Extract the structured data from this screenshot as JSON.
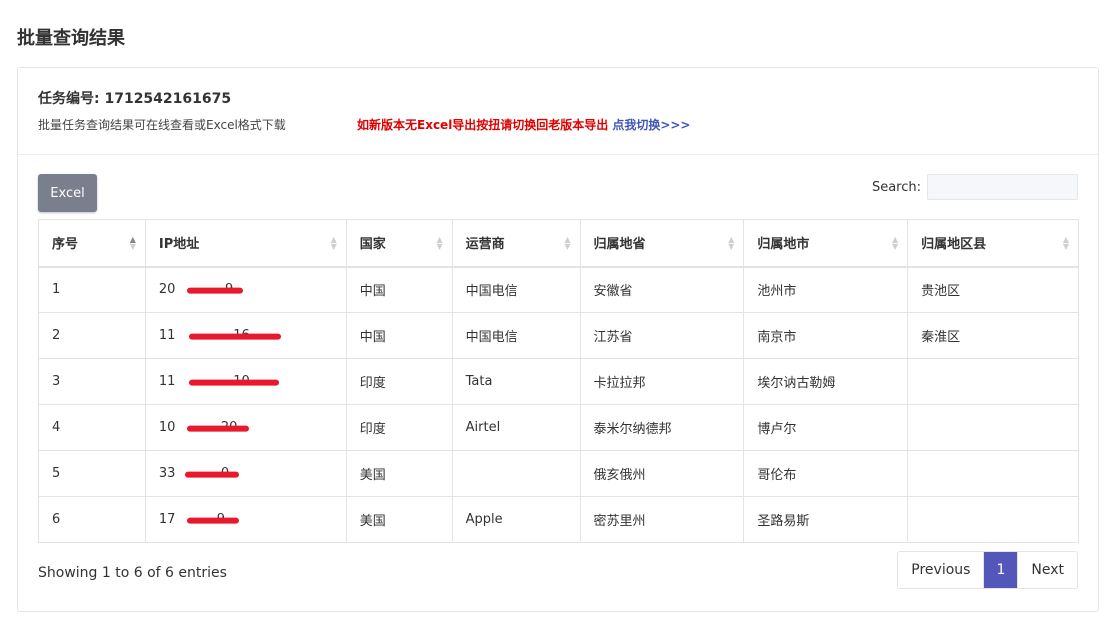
{
  "page": {
    "title": "批量查询结果"
  },
  "task": {
    "id_label": "任务编号: 1712542161675",
    "description": "批量任务查询结果可在线查看或Excel格式下载",
    "notice": "如新版本无Excel导出按扭请切换回老版本导出",
    "switch_link": "点我切换>>>"
  },
  "toolbar": {
    "excel_label": "Excel",
    "search_label": "Search:",
    "search_value": ""
  },
  "table": {
    "columns": [
      "序号",
      "IP地址",
      "国家",
      "运营商",
      "归属地省",
      "归属地市",
      "归属地区县"
    ],
    "rows": [
      [
        "1",
        "20           .9",
        "中国",
        "中国电信",
        "安徽省",
        "池州市",
        "贵池区"
      ],
      [
        "2",
        "11              16",
        "中国",
        "中国电信",
        "江苏省",
        "南京市",
        "秦淮区"
      ],
      [
        "3",
        "11              10",
        "印度",
        "Tata",
        "卡拉拉邦",
        "埃尔讷古勒姆",
        ""
      ],
      [
        "4",
        "10           20",
        "印度",
        "Airtel",
        "泰米尔纳德邦",
        "博卢尔",
        ""
      ],
      [
        "5",
        "33           0",
        "美国",
        "",
        "俄亥俄州",
        "哥伦布",
        ""
      ],
      [
        "6",
        "17          9",
        "美国",
        "Apple",
        "密苏里州",
        "圣路易斯",
        ""
      ]
    ]
  },
  "footer": {
    "info": "Showing 1 to 6 of 6 entries",
    "prev_label": "Previous",
    "page_label": "1",
    "next_label": "Next"
  },
  "colors": {
    "accent": "#5257b9",
    "notice": "#e00000",
    "link": "#4055b8",
    "redaction": "#e8192c"
  }
}
